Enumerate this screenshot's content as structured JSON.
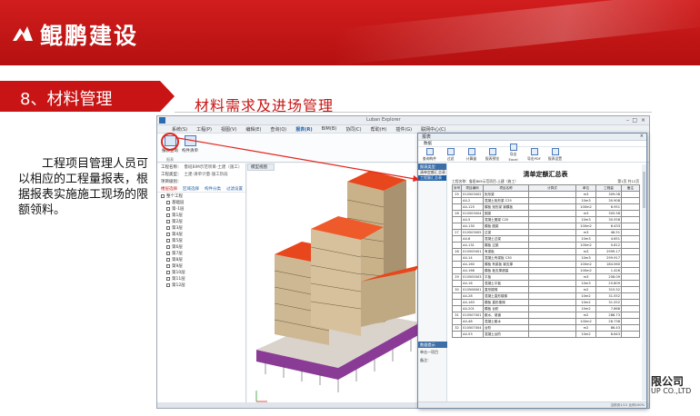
{
  "header": {
    "company": "鲲鹏建设"
  },
  "section": {
    "title": "8、材料管理",
    "subtitle": "材料需求及进场管理"
  },
  "description": "工程项目管理人员可以相应的工程量报表，根据报表实施施工现场的限额领料。",
  "footer": {
    "company_cn": "限公司",
    "company_en": "UP CO.,LTD"
  },
  "app": {
    "title": "Luban Explorer",
    "menu": [
      "系统(S)",
      "工程(P)",
      "视图(V)",
      "编辑(E)",
      "查询(Q)",
      "报表(R)",
      "BIM(B)",
      "协同(C)",
      "帮助(H)",
      "插件(G)",
      "联网中心(C)"
    ],
    "ribbon": {
      "button1": "报表查询",
      "button2": "构件清单",
      "group": "报表"
    },
    "left_panel": {
      "rows": [
        {
          "label": "工程名称：",
          "value": "鲁班BIM示范项目-土建（施工）"
        },
        {
          "label": "工程类型：",
          "value": "土建-清单计量-施工阶段"
        },
        {
          "label": "项目级别：",
          "value": ""
        }
      ],
      "tabs": [
        "楼层选择",
        "区域选择",
        "构件分类",
        "过滤设置"
      ],
      "tree_root": "整个工程",
      "tree_items": [
        "基础层",
        "第-1层",
        "第1层",
        "第2层",
        "第3层",
        "第4层",
        "第5层",
        "第6层",
        "第7层",
        "第8层",
        "第9层",
        "第10层",
        "第11层",
        "第12层"
      ]
    },
    "viewport_tab": "模型视图"
  },
  "dialog": {
    "title": "报表",
    "subtab": "数据",
    "toolbar": [
      "查询构件",
      "过滤",
      "计算量",
      "报表预览",
      "导出Excel",
      "导出PDF",
      "报表设置"
    ],
    "nav_header": "报表类型",
    "nav_items": [
      "清单定额汇总表",
      "工程量汇总表"
    ],
    "bottom": {
      "header": "数据提示",
      "row1": "单击一项目",
      "row2": "备注："
    },
    "report": {
      "title": "清单定额汇总表",
      "project": "工程名称：鲁班BIM示范项目-土建（施工）",
      "page": "第1页 共12页",
      "columns": [
        "序号",
        "项目编码",
        "项目名称",
        "计算式",
        "单位",
        "工程量",
        "备注"
      ],
      "rows": [
        [
          "25",
          "010503002",
          "矩形梁",
          "",
          "m3",
          "309.08",
          ""
        ],
        [
          "",
          "A4-2",
          "混凝土矩形梁 C25",
          "",
          "10m3",
          "30.908",
          ""
        ],
        [
          "",
          "A4-125",
          "模板 矩形梁 钢模板",
          "",
          "100m2",
          "6.951",
          ""
        ],
        [
          "26",
          "010503004",
          "圈梁",
          "",
          "m3",
          "305.58",
          ""
        ],
        [
          "",
          "A4-5",
          "混凝土圈梁 C20",
          "",
          "10m3",
          "30.558",
          ""
        ],
        [
          "",
          "A4-130",
          "模板 圈梁",
          "",
          "100m2",
          "6.433",
          ""
        ],
        [
          "27",
          "010503005",
          "过梁",
          "",
          "m3",
          "46.51",
          ""
        ],
        [
          "",
          "A4-6",
          "混凝土过梁",
          "",
          "10m3",
          "4.651",
          ""
        ],
        [
          "",
          "A4-131",
          "模板 过梁",
          "",
          "100m2",
          "0.812",
          ""
        ],
        [
          "28",
          "010505001",
          "有梁板",
          "",
          "m3",
          "2999.17",
          ""
        ],
        [
          "",
          "A4-14",
          "混凝土有梁板 C30",
          "",
          "10m3",
          "299.917",
          ""
        ],
        [
          "",
          "A4-160",
          "模板 有梁板 钢支撑",
          "",
          "100m2",
          "184.560",
          ""
        ],
        [
          "",
          "A4-166",
          "模板 板支撑超高",
          "",
          "100m2",
          "1.426",
          ""
        ],
        [
          "29",
          "010505003",
          "平板",
          "",
          "m3",
          "258.09",
          ""
        ],
        [
          "",
          "A4-16",
          "混凝土平板",
          "",
          "10m3",
          "25.809",
          ""
        ],
        [
          "30",
          "010506001",
          "直形楼梯",
          "",
          "m2",
          "315.52",
          ""
        ],
        [
          "",
          "A4-28",
          "混凝土直形楼梯",
          "",
          "10m2",
          "31.552",
          ""
        ],
        [
          "",
          "A4-183",
          "模板 直形楼梯",
          "",
          "10m2",
          "31.552",
          ""
        ],
        [
          "",
          "A4-201",
          "模板 台阶",
          "",
          "10m2",
          "7.868",
          ""
        ],
        [
          "31",
          "010507001",
          "散水、坡道",
          "",
          "m2",
          "288.73",
          ""
        ],
        [
          "",
          "A4-48",
          "混凝土散水",
          "",
          "100m2",
          "28.738",
          ""
        ],
        [
          "32",
          "010507004",
          "台阶",
          "",
          "m2",
          "86.43",
          ""
        ],
        [
          "",
          "A4-53",
          "混凝土台阶",
          "",
          "10m2",
          "8.643",
          ""
        ]
      ]
    },
    "status": "当前页1/12 比例100%"
  },
  "colors": {
    "brand_red": "#c81414",
    "model_roof": "#e8461c",
    "model_base": "#8a3b96"
  }
}
